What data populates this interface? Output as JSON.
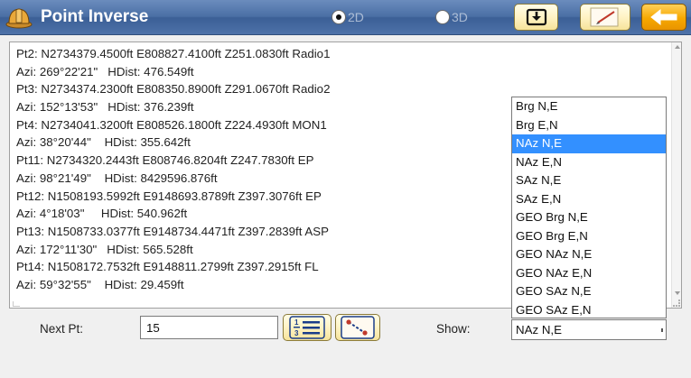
{
  "window": {
    "title": "Point Inverse",
    "mode_options": [
      {
        "label": "2D",
        "selected": true
      },
      {
        "label": "3D",
        "selected": false
      }
    ]
  },
  "toolbar": {
    "save_icon": "save-to-tray-icon",
    "edit_icon": "pencil-edit-icon",
    "back_icon": "back-arrow-icon"
  },
  "results": {
    "lines": [
      "Pt2: N2734379.4500ft E808827.4100ft Z251.0830ft Radio1",
      "Azi: 269°22'21\"   HDist: 476.549ft",
      "Pt3: N2734374.2300ft E808350.8900ft Z291.0670ft Radio2",
      "Azi: 152°13'53\"   HDist: 376.239ft",
      "Pt4: N2734041.3200ft E808526.1800ft Z224.4930ft MON1",
      "Azi: 38°20'44\"    HDist: 355.642ft",
      "Pt11: N2734320.2443ft E808746.8204ft Z247.7830ft EP",
      "Azi: 98°21'49\"    HDist: 8429596.876ft",
      "Pt12: N1508193.5992ft E9148693.8789ft Z397.3076ft EP",
      "Azi: 4°18'03\"     HDist: 540.962ft",
      "Pt13: N1508733.0377ft E9148734.4471ft Z397.2839ft ASP",
      "Azi: 172°11'30\"   HDist: 565.528ft",
      "Pt14: N1508172.7532ft E9148811.2799ft Z397.2915ft FL",
      "Azi: 59°32'55\"    HDist: 29.459ft"
    ]
  },
  "show_dropdown": {
    "options": [
      "Brg N,E",
      "Brg E,N",
      "NAz N,E",
      "NAz E,N",
      "SAz N,E",
      "SAz E,N",
      "GEO Brg N,E",
      "GEO Brg E,N",
      "GEO NAz N,E",
      "GEO NAz E,N",
      "GEO SAz N,E",
      "GEO SAz E,N"
    ],
    "selected_index": 2
  },
  "controls": {
    "next_pt_label": "Next Pt:",
    "next_pt_value": "15",
    "list_button_icon": "numbered-list-icon",
    "line_button_icon": "point-line-icon",
    "show_label": "Show:",
    "show_value": "NAz N,E"
  },
  "colors": {
    "titlebar": "#4a6fa5",
    "button_gold": "#fff3c4",
    "back_button": "#f6a800",
    "selection": "#3390ff"
  }
}
